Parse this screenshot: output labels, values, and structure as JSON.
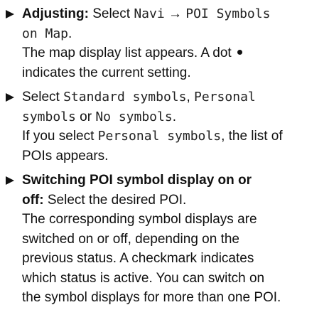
{
  "steps": [
    {
      "heading": "Adjusting:",
      "t1": "Select",
      "menu": "Navi",
      "arrow": "→",
      "menu_item_a": "POI Symbols",
      "menu_item_b": "on Map",
      "t2": ".",
      "result_1": "The map display list appears. A dot",
      "result_2": "indicates the current setting."
    },
    {
      "t1": "Select",
      "opt1": "Standard symbols",
      "comma": ",",
      "opt2a": "Personal",
      "opt2b": "symbols",
      "or": "or",
      "opt3": "No symbols",
      "period": ".",
      "if_1": "If you select",
      "opt_personal": "Personal symbols",
      "if_2": ", the list of",
      "if_3": "POIs appears."
    },
    {
      "heading_1": "Switching POI symbol display on or",
      "heading_2": "off:",
      "instr": "Select the desired POI.",
      "desc_1": "The corresponding symbol displays are",
      "desc_2": "switched on or off, depending on the",
      "desc_3": "previous status. A checkmark indicates",
      "desc_4": "which status is active. You can switch on",
      "desc_5": "the symbol displays for more than one POI."
    }
  ]
}
